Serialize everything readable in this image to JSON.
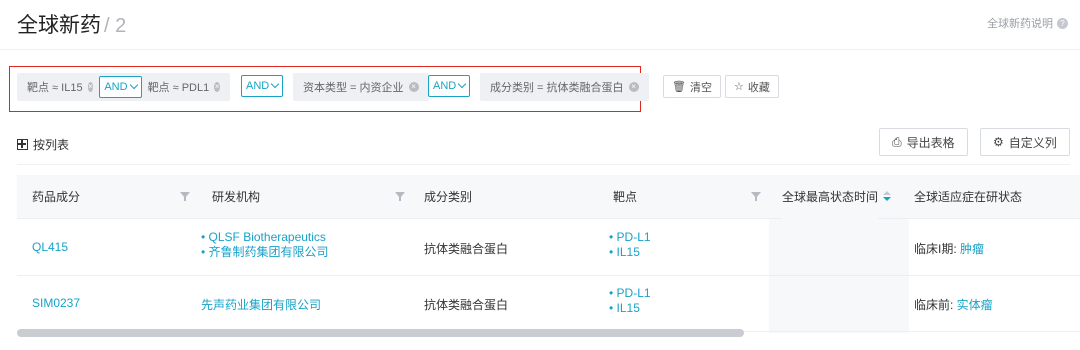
{
  "header": {
    "title": "全球新药",
    "count": "/ 2",
    "help_label": "全球新药说明"
  },
  "filters": {
    "chips": [
      {
        "label": "靶点 ≈ IL15"
      },
      {
        "label": "靶点 ≈ PDL1"
      },
      {
        "label": "资本类型 = 内资企业"
      },
      {
        "label": "成分类别 = 抗体类融合蛋白"
      }
    ],
    "and_label": "AND",
    "clear_label": "清空",
    "save_label": "收藏",
    "highlight_color": "#e0271b"
  },
  "list": {
    "view_label": "按列表",
    "export_label": "导出表格",
    "custom_cols_label": "自定义列"
  },
  "table": {
    "columns": [
      "药品成分",
      "研发机构",
      "成分类别",
      "靶点",
      "全球最高状态时间",
      "全球适应症在研状态"
    ],
    "rows": [
      {
        "drug": "QL415",
        "orgs": [
          "• QLSF Biotherapeutics",
          "• 齐鲁制药集团有限公司"
        ],
        "category": "抗体类融合蛋白",
        "targets": [
          "• PD-L1",
          "• IL15"
        ],
        "status_time": "",
        "status_prefix": "临床I期: ",
        "status_indication": "肿瘤"
      },
      {
        "drug": "SIM0237",
        "orgs": [
          "先声药业集团有限公司"
        ],
        "category": "抗体类融合蛋白",
        "targets": [
          "• PD-L1",
          "• IL15"
        ],
        "status_time": "",
        "status_prefix": "临床前: ",
        "status_indication": "实体瘤"
      }
    ]
  },
  "colors": {
    "accent": "#17a2c8"
  }
}
